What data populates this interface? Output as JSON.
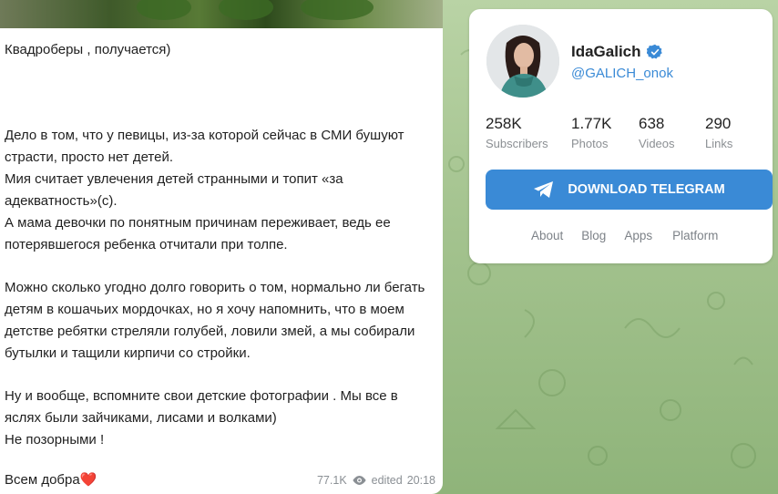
{
  "message": {
    "paragraphs": [
      "Квадроберы , получается)",
      "Дело в том, что у певицы, из-за которой сейчас в СМИ бушуют страсти, просто нет детей.\nМия считает увлечения детей странными и топит «за адекватность»(с).\nА мама девочки по понятным причинам переживает, ведь ее потерявшегося ребенка отчитали при толпе.",
      "Можно сколько угодно долго говорить о том, нормально ли бегать детям в кошачьих мордочках, но я хочу напомнить, что в моем детстве ребятки стреляли голубей, ловили змей, а мы собирали бутылки и тащили кирпичи со стройки.",
      "Ну и вообще, вспомните свои детские фотографии . Мы все в яслях были зайчиками, лисами и волками)\nНе позорными !",
      "Всем добра"
    ],
    "heart": "❤️",
    "views": "77.1K",
    "edited_label": "edited",
    "time": "20:18"
  },
  "channel": {
    "name": "IdaGalich",
    "handle": "@GALICH_onok",
    "stats": [
      {
        "value": "258K",
        "label": "Subscribers"
      },
      {
        "value": "1.77K",
        "label": "Photos"
      },
      {
        "value": "638",
        "label": "Videos"
      },
      {
        "value": "290",
        "label": "Links"
      }
    ],
    "download_label": "DOWNLOAD TELEGRAM",
    "links": [
      "About",
      "Blog",
      "Apps",
      "Platform"
    ]
  },
  "colors": {
    "accent": "#3a8ad6",
    "verified": "#3a8ad6",
    "background": "#a4c38f"
  }
}
